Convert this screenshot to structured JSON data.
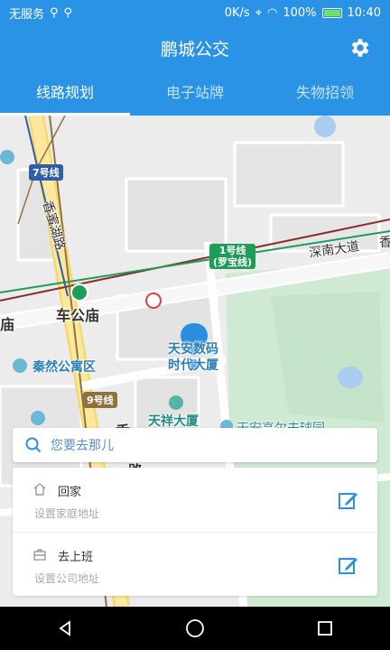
{
  "status_bar": {
    "carrier": "无服务",
    "network_speed": "0K/s",
    "battery": "100%",
    "time": "10:40"
  },
  "header": {
    "title": "鹏城公交",
    "settings_icon": "gear-icon"
  },
  "tabs": [
    {
      "label": "线路规划",
      "active": true
    },
    {
      "label": "电子站牌",
      "active": false
    },
    {
      "label": "失物招领",
      "active": false
    }
  ],
  "map": {
    "labels": {
      "xiangmi_road": "香蜜湖路",
      "che_gong_miao": "车公庙",
      "miao_partial": "庙",
      "shennan_avenue": "深南大道",
      "xiang_partial": "香",
      "qinran_apartment": "秦然公寓区",
      "tianxiang_building": "天祥大厦",
      "tianan_building": "天安数码\n时代大厦",
      "tianan_golf": "天安高尔夫球园",
      "xiang_bottom": "香",
      "lu_bottom": "路"
    },
    "lines": {
      "line7": "7号线",
      "line1": "1号线\n(罗宝线)",
      "line9": "9号线"
    },
    "colors": {
      "line1": "#1e9d57",
      "line7": "#2f5da8",
      "line9": "#8e7340",
      "railway": "#8b2c2c"
    }
  },
  "search": {
    "placeholder": "您要去那儿"
  },
  "addresses": [
    {
      "title": "回家",
      "subtitle": "设置家庭地址",
      "icon": "home-icon"
    },
    {
      "title": "去上班",
      "subtitle": "设置公司地址",
      "icon": "briefcase-icon"
    }
  ],
  "nav": {
    "back_icon": "back-icon",
    "home_icon": "home-circle-icon",
    "recents_icon": "recents-icon"
  }
}
